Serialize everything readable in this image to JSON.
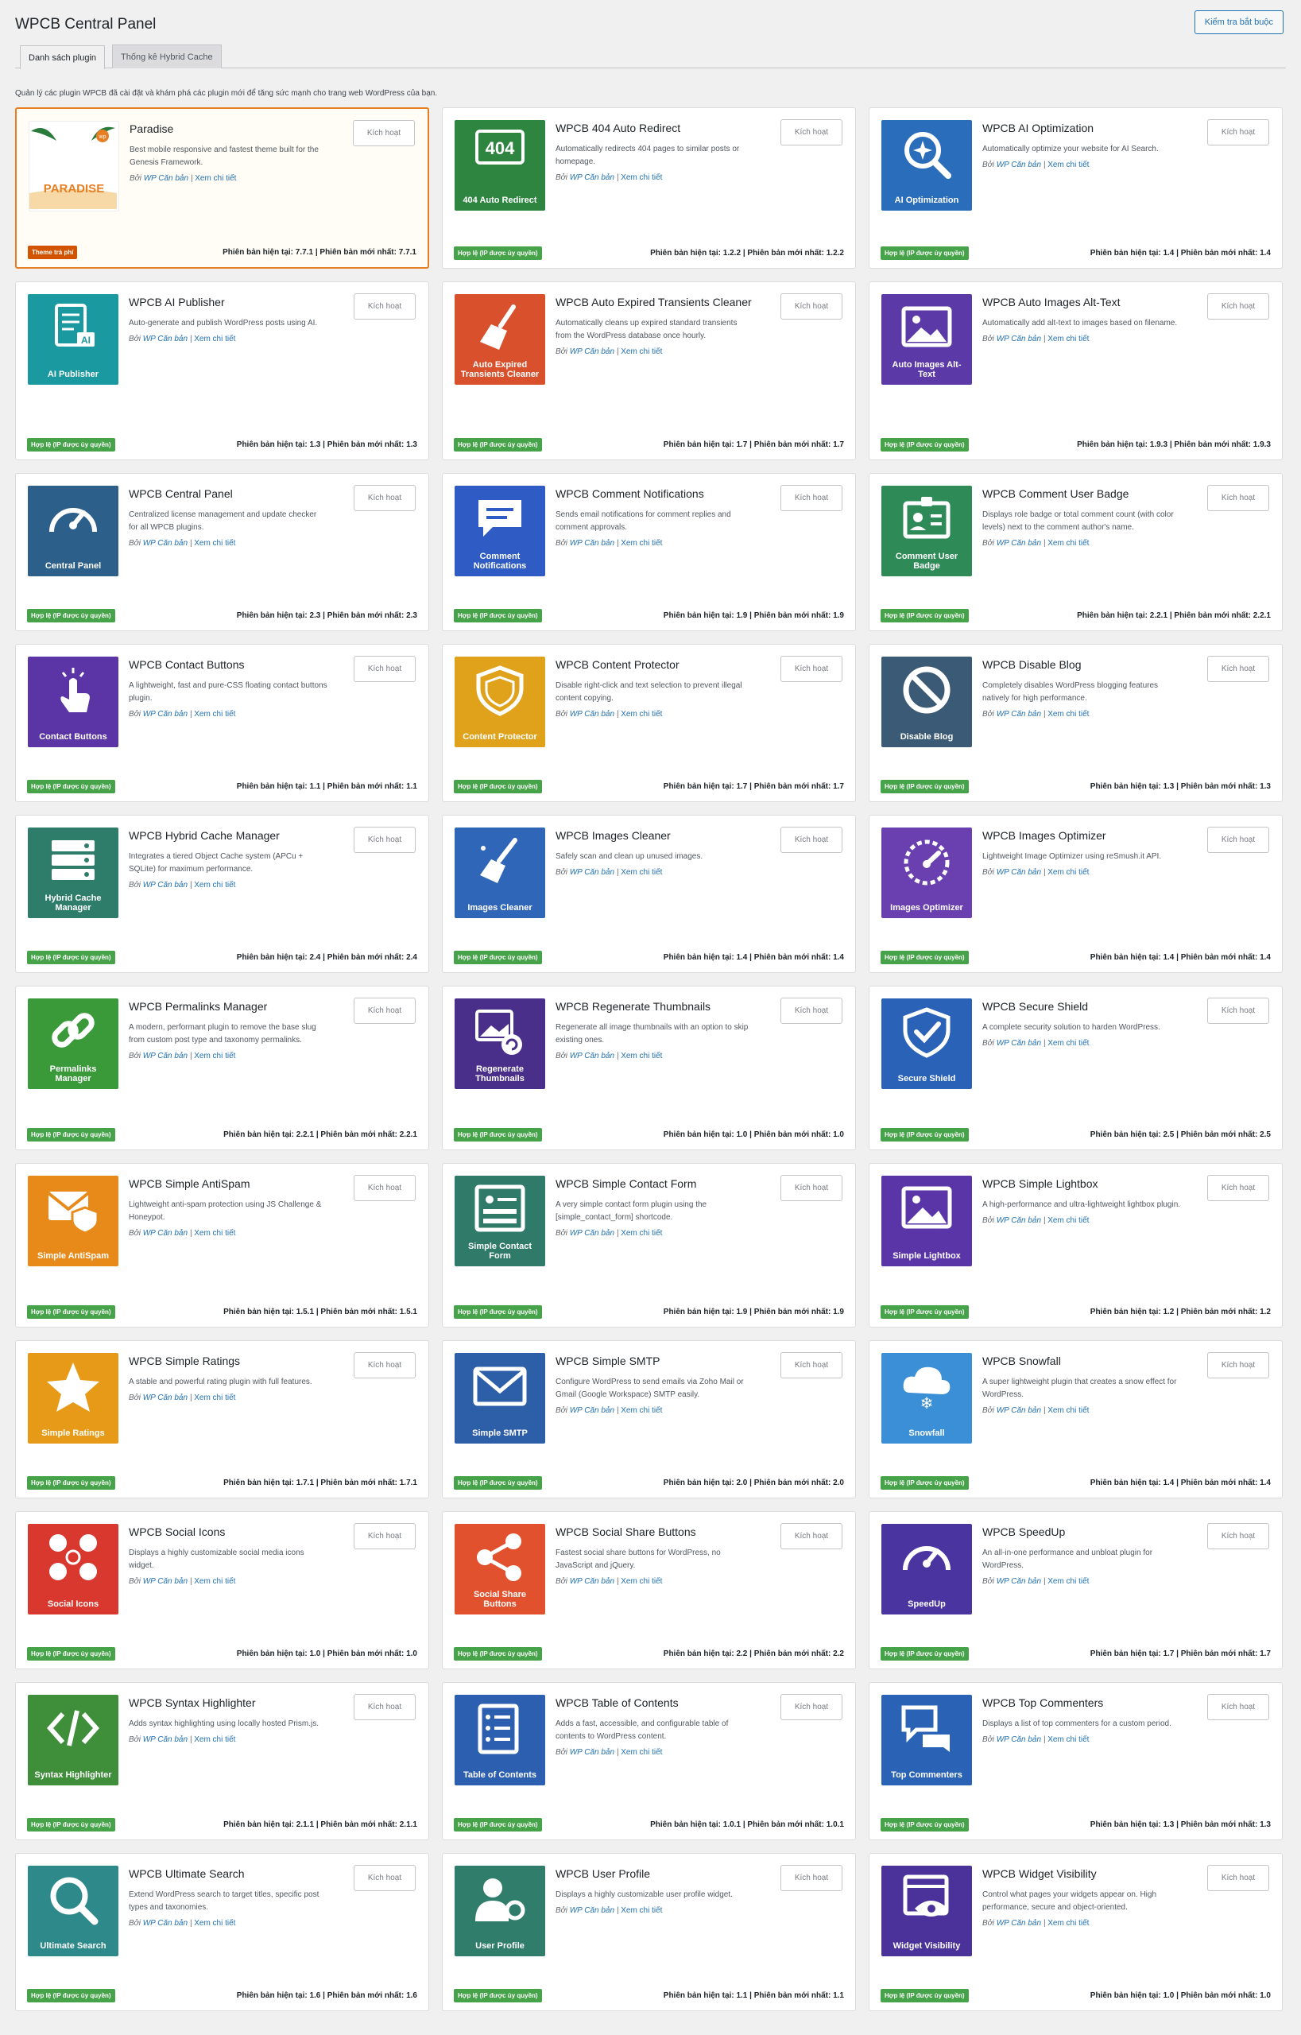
{
  "header": {
    "title": "WPCB Central Panel",
    "check_button": "Kiểm tra bắt buộc"
  },
  "tabs": [
    {
      "label": "Danh sách plugin",
      "active": true
    },
    {
      "label": "Thống kê Hybrid Cache",
      "active": false
    }
  ],
  "intro": "Quản lý các plugin WPCB đã cài đặt và khám phá các plugin mới để tăng sức mạnh cho trang web WordPress của bạn.",
  "common": {
    "activate": "Kích hoạt",
    "by": "Bởi",
    "author": "WP Căn bản",
    "sep": "|",
    "details": "Xem chi tiết",
    "valid_badge": "Hợp lệ (IP được ủy quyền)",
    "paid_badge": "Theme trả phí",
    "cur_label": "Phiên bản hiện tại:",
    "new_label": "Phiên bản mới nhất:"
  },
  "colors": {
    "accent": "#2271b1",
    "valid": "#46a34a",
    "paid": "#d35400",
    "featured_border": "#e67e22"
  },
  "plugins": [
    {
      "name": "Paradise",
      "desc": "Best mobile responsive and fastest theme built for the Genesis Framework.",
      "icon_label": "PARADISE",
      "icon": "palm-theme-icon",
      "color": "#ffffff",
      "cur": "7.7.1",
      "new": "7.7.1",
      "badge": "paid"
    },
    {
      "name": "WPCB 404 Auto Redirect",
      "desc": "Automatically redirects 404 pages to similar posts or homepage.",
      "icon_label": "404 Auto Redirect",
      "icon": "404-icon",
      "color": "#2e8540",
      "cur": "1.2.2",
      "new": "1.2.2"
    },
    {
      "name": "WPCB AI Optimization",
      "desc": "Automatically optimize your website for AI Search.",
      "icon_label": "AI Optimization",
      "icon": "ai-search-icon",
      "color": "#2a6ebb",
      "cur": "1.4",
      "new": "1.4"
    },
    {
      "name": "WPCB AI Publisher",
      "desc": "Auto-generate and publish WordPress posts using AI.",
      "icon_label": "AI Publisher",
      "icon": "ai-doc-icon",
      "color": "#1a9aa0",
      "cur": "1.3",
      "new": "1.3"
    },
    {
      "name": "WPCB Auto Expired Transients Cleaner",
      "desc": "Automatically cleans up expired standard transients from the WordPress database once hourly.",
      "icon_label": "Auto Expired Transients Cleaner",
      "icon": "broom-icon",
      "color": "#d9512c",
      "cur": "1.7",
      "new": "1.7"
    },
    {
      "name": "WPCB Auto Images Alt-Text",
      "desc": "Automatically add alt-text to images based on filename.",
      "icon_label": "Auto Images Alt-Text",
      "icon": "image-icon",
      "color": "#5b3aa8",
      "cur": "1.9.3",
      "new": "1.9.3"
    },
    {
      "name": "WPCB Central Panel",
      "desc": "Centralized license management and update checker for all WPCB plugins.",
      "icon_label": "Central Panel",
      "icon": "gauge-icon",
      "color": "#2c5f8a",
      "cur": "2.3",
      "new": "2.3"
    },
    {
      "name": "WPCB Comment Notifications",
      "desc": "Sends email notifications for comment replies and comment approvals.",
      "icon_label": "Comment Notifications",
      "icon": "chat-icon",
      "color": "#2f5cc4",
      "cur": "1.9",
      "new": "1.9"
    },
    {
      "name": "WPCB Comment User Badge",
      "desc": "Displays role badge or total comment count (with color levels) next to the comment author's name.",
      "icon_label": "Comment User Badge",
      "icon": "badge-icon",
      "color": "#2e8b57",
      "cur": "2.2.1",
      "new": "2.2.1"
    },
    {
      "name": "WPCB Contact Buttons",
      "desc": "A lightweight, fast and pure-CSS floating contact buttons plugin.",
      "icon_label": "Contact Buttons",
      "icon": "tap-icon",
      "color": "#5b34a6",
      "cur": "1.1",
      "new": "1.1"
    },
    {
      "name": "WPCB Content Protector",
      "desc": "Disable right-click and text selection to prevent illegal content copying.",
      "icon_label": "Content Protector",
      "icon": "shield-icon",
      "color": "#e0a21b",
      "cur": "1.7",
      "new": "1.7"
    },
    {
      "name": "WPCB Disable Blog",
      "desc": "Completely disables WordPress blogging features natively for high performance.",
      "icon_label": "Disable Blog",
      "icon": "ban-icon",
      "color": "#3b5a75",
      "cur": "1.3",
      "new": "1.3"
    },
    {
      "name": "WPCB Hybrid Cache Manager",
      "desc": "Integrates a tiered Object Cache system (APCu + SQLite) for maximum performance.",
      "icon_label": "Hybrid Cache Manager",
      "icon": "server-icon",
      "color": "#2e7d6b",
      "cur": "2.4",
      "new": "2.4"
    },
    {
      "name": "WPCB Images Cleaner",
      "desc": "Safely scan and clean up unused images.",
      "icon_label": "Images Cleaner",
      "icon": "brush-icon",
      "color": "#2f66b8",
      "cur": "1.4",
      "new": "1.4"
    },
    {
      "name": "WPCB Images Optimizer",
      "desc": "Lightweight Image Optimizer using reSmush.it API.",
      "icon_label": "Images Optimizer",
      "icon": "speed-icon",
      "color": "#6a3fb0",
      "cur": "1.4",
      "new": "1.4"
    },
    {
      "name": "WPCB Permalinks Manager",
      "desc": "A modern, performant plugin to remove the base slug from custom post type and taxonomy permalinks.",
      "icon_label": "Permalinks Manager",
      "icon": "link-icon",
      "color": "#3a9a3a",
      "cur": "2.2.1",
      "new": "2.2.1"
    },
    {
      "name": "WPCB Regenerate Thumbnails",
      "desc": "Regenerate all image thumbnails with an option to skip existing ones.",
      "icon_label": "Regenerate Thumbnails",
      "icon": "thumbs-icon",
      "color": "#4a2f8a",
      "cur": "1.0",
      "new": "1.0"
    },
    {
      "name": "WPCB Secure Shield",
      "desc": "A complete security solution to harden WordPress.",
      "icon_label": "Secure Shield",
      "icon": "check-shield-icon",
      "color": "#2a62b8",
      "cur": "2.5",
      "new": "2.5"
    },
    {
      "name": "WPCB Simple AntiSpam",
      "desc": "Lightweight anti-spam protection using JS Challenge & Honeypot.",
      "icon_label": "Simple AntiSpam",
      "icon": "mail-shield-icon",
      "color": "#e88a1a",
      "cur": "1.5.1",
      "new": "1.5.1"
    },
    {
      "name": "WPCB Simple Contact Form",
      "desc": "A very simple contact form plugin using the [simple_contact_form] shortcode.",
      "icon_label": "Simple Contact Form",
      "icon": "form-icon",
      "color": "#2f7a68",
      "cur": "1.9",
      "new": "1.9"
    },
    {
      "name": "WPCB Simple Lightbox",
      "desc": "A high-performance and ultra-lightweight lightbox plugin.",
      "icon_label": "Simple Lightbox",
      "icon": "frame-icon",
      "color": "#5a35a8",
      "cur": "1.2",
      "new": "1.2"
    },
    {
      "name": "WPCB Simple Ratings",
      "desc": "A stable and powerful rating plugin with full features.",
      "icon_label": "Simple Ratings",
      "icon": "star-icon",
      "color": "#e69a17",
      "cur": "1.7.1",
      "new": "1.7.1"
    },
    {
      "name": "WPCB Simple SMTP",
      "desc": "Configure WordPress to send emails via Zoho Mail or Gmail (Google Workspace) SMTP easily.",
      "icon_label": "Simple SMTP",
      "icon": "envelope-icon",
      "color": "#2d5ea8",
      "cur": "2.0",
      "new": "2.0"
    },
    {
      "name": "WPCB Snowfall",
      "desc": "A super lightweight plugin that creates a snow effect for WordPress.",
      "icon_label": "Snowfall",
      "icon": "snow-icon",
      "color": "#3a8fd6",
      "cur": "1.4",
      "new": "1.4"
    },
    {
      "name": "WPCB Social Icons",
      "desc": "Displays a highly customizable social media icons widget.",
      "icon_label": "Social Icons",
      "icon": "social-icon",
      "color": "#d8382e",
      "cur": "1.0",
      "new": "1.0"
    },
    {
      "name": "WPCB Social Share Buttons",
      "desc": "Fastest social share buttons for WordPress, no JavaScript and jQuery.",
      "icon_label": "Social Share Buttons",
      "icon": "share-icon",
      "color": "#e2512d",
      "cur": "2.2",
      "new": "2.2"
    },
    {
      "name": "WPCB SpeedUp",
      "desc": "An all-in-one performance and unbloat plugin for WordPress.",
      "icon_label": "SpeedUp",
      "icon": "speedometer-icon",
      "color": "#4a35a0",
      "cur": "1.7",
      "new": "1.7"
    },
    {
      "name": "WPCB Syntax Highlighter",
      "desc": "Adds syntax highlighting using locally hosted Prism.js.",
      "icon_label": "Syntax Highlighter",
      "icon": "code-icon",
      "color": "#3e8e3a",
      "cur": "2.1.1",
      "new": "2.1.1"
    },
    {
      "name": "WPCB Table of Contents",
      "desc": "Adds a fast, accessible, and configurable table of contents to WordPress content.",
      "icon_label": "Table of Contents",
      "icon": "list-icon",
      "color": "#2d5fb0",
      "cur": "1.0.1",
      "new": "1.0.1"
    },
    {
      "name": "WPCB Top Commenters",
      "desc": "Displays a list of top commenters for a custom period.",
      "icon_label": "Top Commenters",
      "icon": "comments-icon",
      "color": "#2a63b6",
      "cur": "1.3",
      "new": "1.3"
    },
    {
      "name": "WPCB Ultimate Search",
      "desc": "Extend WordPress search to target titles, specific post types and taxonomies.",
      "icon_label": "Ultimate Search",
      "icon": "search-icon",
      "color": "#2e8a8a",
      "cur": "1.6",
      "new": "1.6"
    },
    {
      "name": "WPCB User Profile",
      "desc": "Displays a highly customizable user profile widget.",
      "icon_label": "User Profile",
      "icon": "user-gear-icon",
      "color": "#2f7d6a",
      "cur": "1.1",
      "new": "1.1"
    },
    {
      "name": "WPCB Widget Visibility",
      "desc": "Control what pages your widgets appear on. High performance, secure and object-oriented.",
      "icon_label": "Widget Visibility",
      "icon": "eye-window-icon",
      "color": "#4a329a",
      "cur": "1.0",
      "new": "1.0"
    }
  ]
}
